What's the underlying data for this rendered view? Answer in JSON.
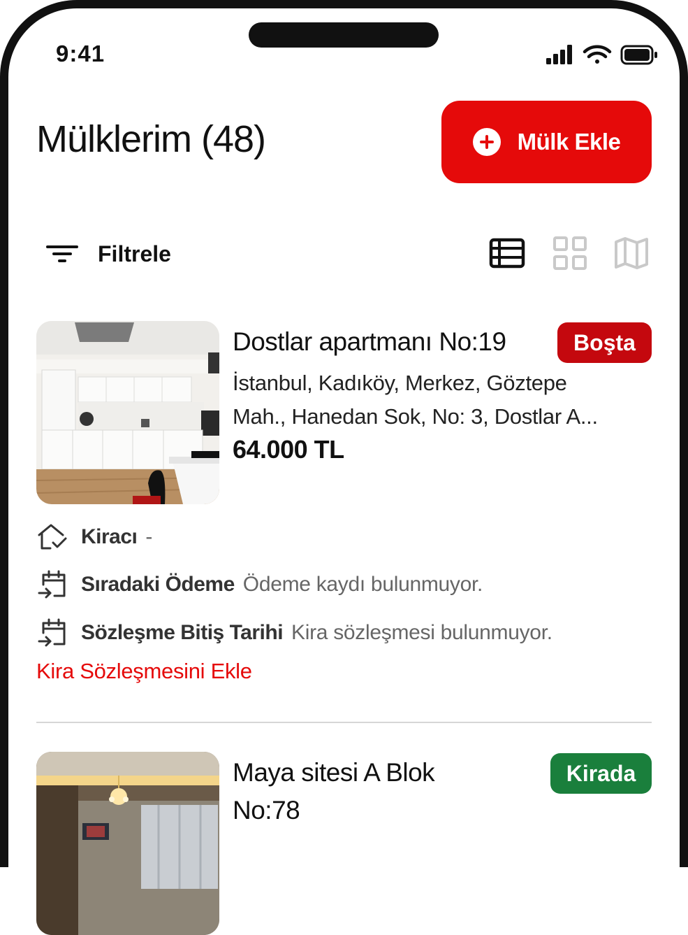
{
  "status_bar": {
    "time": "9:41"
  },
  "header": {
    "title": "Mülklerim (48)",
    "add_button_label": "Mülk Ekle"
  },
  "toolbar": {
    "filter_label": "Filtrele",
    "active_view": "list"
  },
  "properties": [
    {
      "name": "Dostlar apartmanı No:19",
      "status": "Boşta",
      "status_color": "#c4080e",
      "address_line1": "İstanbul, Kadıköy, Merkez, Göztepe",
      "address_line2": "Mah., Hanedan Sok, No: 3, Dostlar A...",
      "price": "64.000 TL",
      "tenant_label": "Kiracı",
      "tenant_value": "-",
      "next_payment_label": "Sıradaki Ödeme",
      "next_payment_value": "Ödeme kaydı bulunmuyor.",
      "contract_end_label": "Sözleşme Bitiş Tarihi",
      "contract_end_value": "Kira sözleşmesi bulunmuyor.",
      "add_contract_label": "Kira Sözleşmesini Ekle"
    },
    {
      "name_line1": "Maya sitesi A Blok",
      "name_line2": "No:78",
      "status": "Kirada",
      "status_color": "#1a7f3c"
    }
  ],
  "colors": {
    "accent": "#e50a0a",
    "vacant": "#c4080e",
    "rented": "#1a7f3c"
  }
}
